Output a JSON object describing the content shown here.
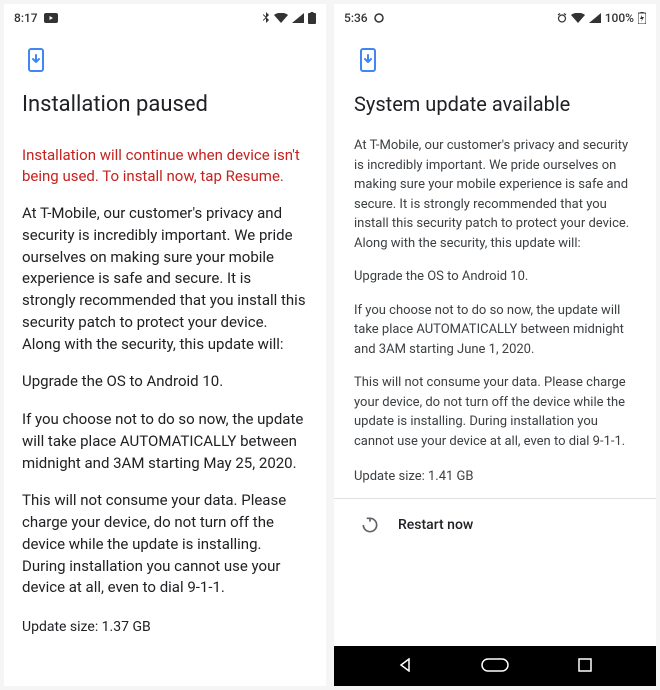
{
  "left": {
    "status": {
      "time": "8:17",
      "battery": ""
    },
    "heading": "Installation paused",
    "warning": "Installation will continue when device isn't being used. To install now, tap Resume.",
    "p1": "At T-Mobile, our customer's privacy and security is incredibly important. We pride ourselves on making sure your mobile experience is safe and secure. It is strongly recommended that you install this security patch to protect your device. Along with the security, this update will:",
    "p2": "Upgrade the OS to Android 10.",
    "p3": "If you choose not to do so now, the update will take place AUTOMATICALLY between midnight and 3AM starting May 25, 2020.",
    "p4": "This will not consume your data. Please charge your device, do not turn off the device while the update is installing. During installation you cannot use your device at all, even to dial 9-1-1.",
    "size": "Update size: 1.37 GB"
  },
  "right": {
    "status": {
      "time": "5:36",
      "battery": "100%"
    },
    "heading": "System update available",
    "p1": "At T-Mobile, our customer's privacy and security is incredibly important. We pride ourselves on making sure your mobile experience is safe and secure. It is strongly recommended that you install this security patch to protect your device. Along with the security, this update will:",
    "p2": "Upgrade the OS to Android 10.",
    "p3": "If you choose not to do so now, the update will take place AUTOMATICALLY between midnight and 3AM starting June 1, 2020.",
    "p4": "This will not consume your data. Please charge your device, do not turn off the device while the update is installing. During installation you cannot use your device at all, even to dial 9-1-1.",
    "size": "Update size: 1.41 GB",
    "restart": "Restart now"
  }
}
